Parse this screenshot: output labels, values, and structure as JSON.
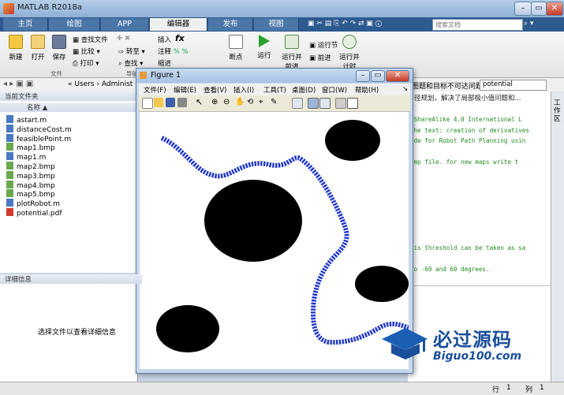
{
  "window": {
    "title": "MATLAB R2018a"
  },
  "tabs": [
    "主页",
    "绘图",
    "APP",
    "编辑器",
    "发布",
    "视图"
  ],
  "search": {
    "placeholder": "搜索文档"
  },
  "ribbon": {
    "file": {
      "new": "新建",
      "open": "打开",
      "save": "保存",
      "find_file": "查找文件",
      "compare": "比较",
      "print": "打印",
      "section": "文件"
    },
    "nav": {
      "goto": "转至",
      "find": "查找",
      "section": "导航"
    },
    "edit": {
      "insert": "插入",
      "fx": "fx",
      "comment": "注释",
      "indent": "缩进"
    },
    "breakpoint": "断点",
    "run": {
      "run": "运行",
      "run_advance": "运行并前进",
      "run_section": "运行节",
      "advance": "前进",
      "run_time": "运行并计时"
    }
  },
  "pathbar": {
    "text": "« Users › Administ",
    "right_text": "图题和目标不可达问题",
    "right_file": "potential"
  },
  "left_panel": {
    "header": "当前文件夹",
    "column": "名称",
    "files": [
      "astart.m",
      "distanceCost.m",
      "feasiblePoint.m",
      "map1.bmp",
      "map1.m",
      "map2.bmp",
      "map3.bmp",
      "map4.bmp",
      "map5.bmp",
      "plotRobot.m",
      "potential.pdf"
    ],
    "detail_header": "详细信息",
    "detail_text": "选择文件以查看详细信息"
  },
  "editor": {
    "comment_top": "径规划，解决了局部极小值问题和...",
    "lines": [
      "-ShareAlike 4.0 International L",
      "the text: creation of derivatives",
      "ode for Robot Path Planning usin",
      "",
      "bmp file. for new maps write t",
      "",
      "",
      "",
      "",
      "",
      "",
      "",
      "his threshold can be taken as sa",
      "",
      "to -60 and 60 degrees."
    ],
    "side_label": "工作区"
  },
  "figure": {
    "title": "Figure 1",
    "menu": [
      "文件(F)",
      "编辑(E)",
      "查看(V)",
      "插入(I)",
      "工具(T)",
      "桌面(D)",
      "窗口(W)",
      "帮助(H)"
    ]
  },
  "status": {
    "row_label": "行",
    "row": "1",
    "col_label": "列",
    "col": "1"
  },
  "watermark": {
    "title": "必过源码",
    "url": "Biguo100.com"
  },
  "colors": {
    "path": "#1f35c9",
    "obstacle": "#000000",
    "ribbon_tab": "#2d5a8f"
  }
}
